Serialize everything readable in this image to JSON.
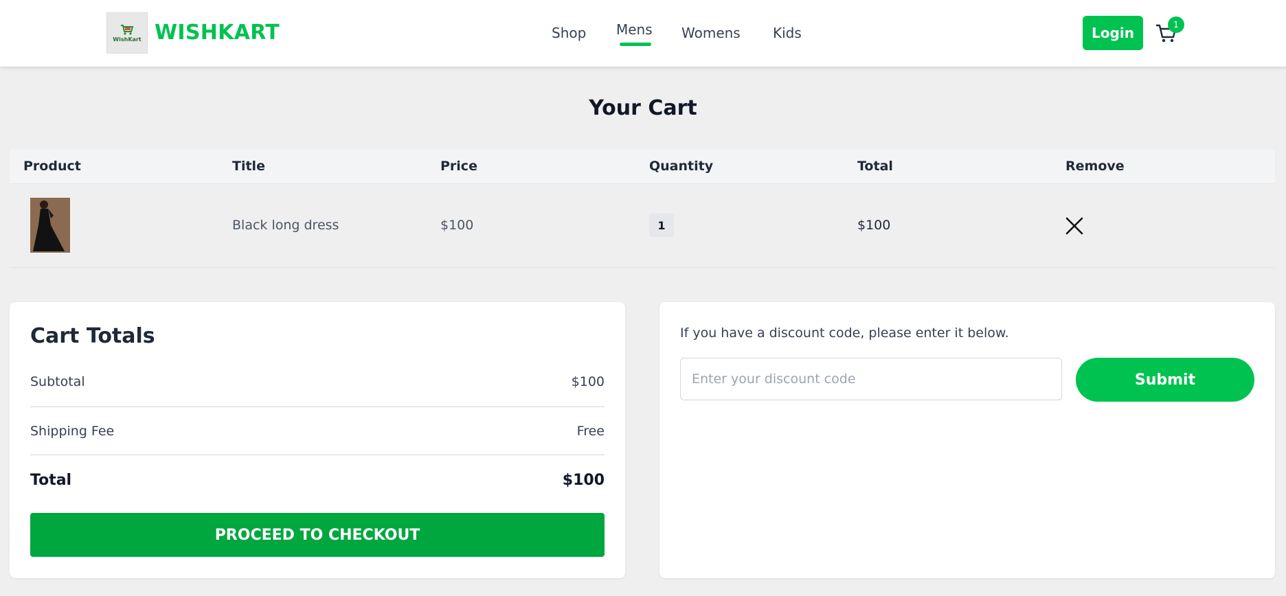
{
  "header": {
    "logo_text": "WishKart",
    "brand": "WISHKART",
    "nav": [
      {
        "label": "Shop",
        "active": false
      },
      {
        "label": "Mens",
        "active": true
      },
      {
        "label": "Womens",
        "active": false
      },
      {
        "label": "Kids",
        "active": false
      }
    ],
    "login_label": "Login",
    "cart_count": "1",
    "accent_color": "#00c251"
  },
  "page_title": "Your Cart",
  "table": {
    "columns": [
      "Product",
      "Title",
      "Price",
      "Quantity",
      "Total",
      "Remove"
    ],
    "rows": [
      {
        "image": "black-long-dress-thumbnail",
        "title": "Black long dress",
        "price": "$100",
        "quantity": "1",
        "total": "$100",
        "remove_icon": "close-icon"
      }
    ]
  },
  "totals": {
    "title": "Cart Totals",
    "rows": [
      {
        "label": "Subtotal",
        "value": "$100"
      },
      {
        "label": "Shipping Fee",
        "value": "Free"
      },
      {
        "label": "Total",
        "value": "$100"
      }
    ],
    "checkout_label": "PROCEED TO CHECKOUT",
    "checkout_color": "#00a63e"
  },
  "discount": {
    "prompt": "If you have a discount code, please enter it below.",
    "placeholder": "Enter your discount code",
    "value": "",
    "submit_label": "Submit"
  }
}
